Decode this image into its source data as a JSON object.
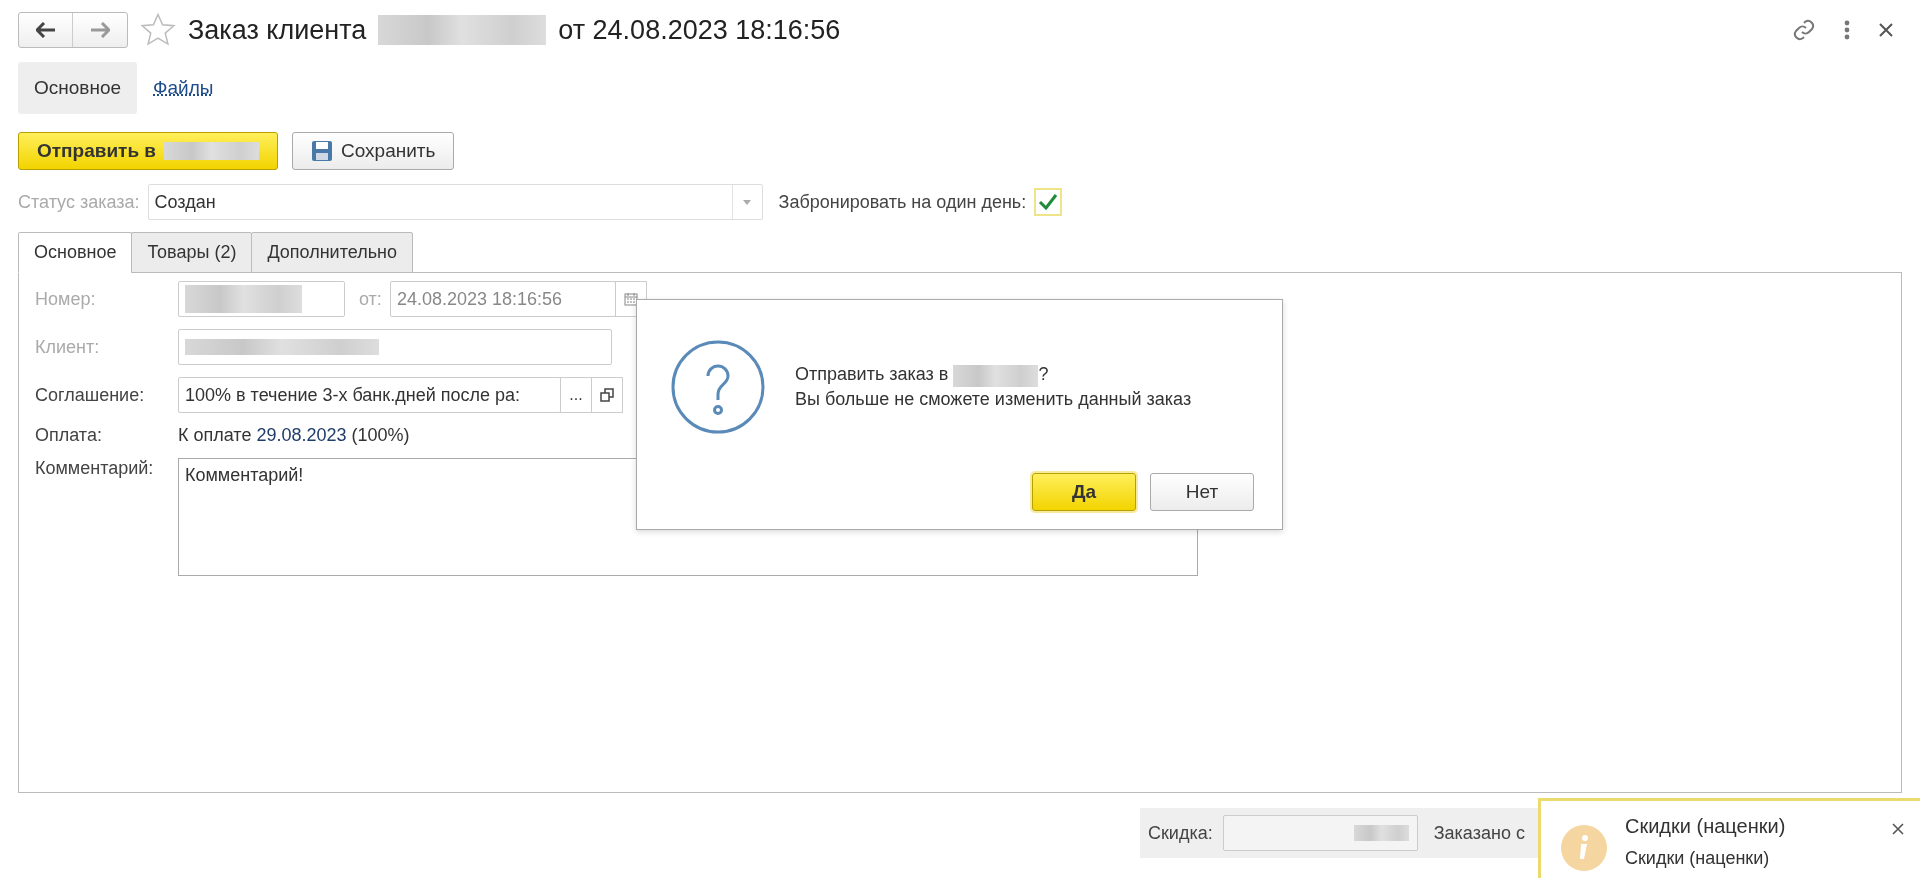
{
  "header": {
    "title_prefix": "Заказ клиента",
    "title_suffix": "от 24.08.2023 18:16:56"
  },
  "sections": [
    {
      "label": "Основное",
      "selected": true
    },
    {
      "label": "Файлы",
      "selected": false
    }
  ],
  "toolbar": {
    "send_button": "Отправить в",
    "save_button": "Сохранить"
  },
  "status": {
    "label": "Статус заказа:",
    "value": "Создан",
    "reserve_label": "Забронировать на один день:",
    "reserve_checked": true
  },
  "tabs": [
    {
      "label": "Основное",
      "selected": true
    },
    {
      "label": "Товары (2)",
      "selected": false
    },
    {
      "label": "Дополнительно",
      "selected": false
    }
  ],
  "form": {
    "number_label": "Номер:",
    "date_label": "от:",
    "date_value": "24.08.2023 18:16:56",
    "client_label": "Клиент:",
    "agreement_label": "Соглашение:",
    "agreement_value": "100% в течение 3-х банк.дней после ра:",
    "agreement_more": "...",
    "payment_label": "Оплата:",
    "payment_prefix": "К оплате",
    "payment_date": "29.08.2023",
    "payment_suffix": "(100%)",
    "comment_label": "Комментарий:",
    "comment_value": "Комментарий!"
  },
  "dialog": {
    "line_1_prefix": "Отправить заказ в",
    "line_1_suffix": "?",
    "line_2": "Вы больше не сможете изменить данный заказ",
    "buttons": [
      {
        "label": "Да",
        "selected": true
      },
      {
        "label": "Нет",
        "selected": false
      }
    ]
  },
  "footer": {
    "discount_label": "Скидка:",
    "ordered_label": "Заказано с"
  },
  "notification": {
    "title": "Скидки (наценки)",
    "text": "Скидки (наценки)"
  }
}
